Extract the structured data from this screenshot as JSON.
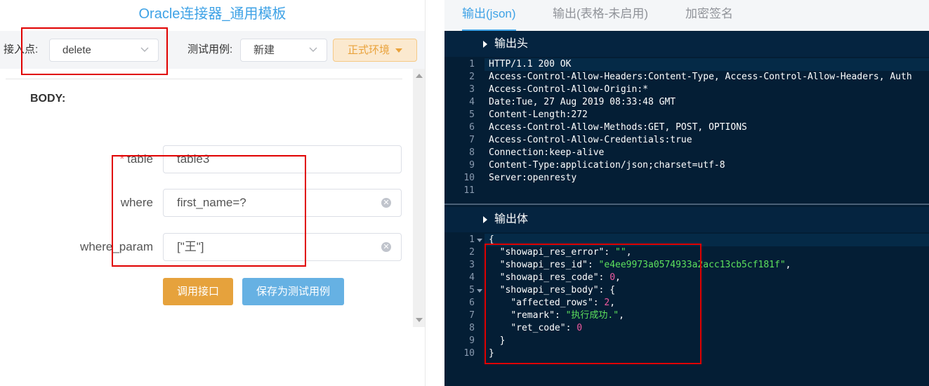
{
  "left": {
    "title": "Oracle连接器_通用模板",
    "endpoint_label": "接入点:",
    "endpoint_value": "delete",
    "testcase_label": "测试用例:",
    "testcase_value": "新建",
    "env_button": "正式环境",
    "body_label": "BODY:",
    "fields": [
      {
        "label": "table",
        "required": "*",
        "value": "table3"
      },
      {
        "label": "where",
        "value": "first_name=?"
      },
      {
        "label": "where_param",
        "value": "[\"王\"]"
      }
    ],
    "call_button": "调用接口",
    "save_button": "保存为测试用例"
  },
  "right": {
    "tabs": [
      "输出(json)",
      "输出(表格-未启用)",
      "加密签名"
    ],
    "active_tab": 0,
    "header_section": "输出头",
    "body_section": "输出体",
    "headers": [
      "HTTP/1.1 200 OK",
      "Access-Control-Allow-Headers:Content-Type, Access-Control-Allow-Headers, Auth",
      "Access-Control-Allow-Origin:*",
      "Date:Tue, 27 Aug 2019 08:33:48 GMT",
      "Content-Length:272",
      "Access-Control-Allow-Methods:GET, POST, OPTIONS",
      "Access-Control-Allow-Credentials:true",
      "Connection:keep-alive",
      "Content-Type:application/json;charset=utf-8",
      "Server:openresty",
      ""
    ],
    "body_json": {
      "line1": "{",
      "err_key": "\"showapi_res_error\"",
      "err_val": "\"\"",
      "id_key": "\"showapi_res_id\"",
      "id_val": "\"e4ee9973a0574933a2acc13cb5cf181f\"",
      "code_key": "\"showapi_res_code\"",
      "code_val": "0",
      "body_key": "\"showapi_res_body\"",
      "rows_key": "\"affected_rows\"",
      "rows_val": "2",
      "remark_key": "\"remark\"",
      "remark_val": "\"执行成功.\"",
      "ret_key": "\"ret_code\"",
      "ret_val": "0",
      "inner_close": "}",
      "outer_close": "}"
    }
  },
  "colors": {
    "accent_blue": "#3ea2e6",
    "editor_bg": "#041e35",
    "string_green": "#5de05d",
    "number_pink": "#f05aa0",
    "annotation_red": "#e00000"
  }
}
